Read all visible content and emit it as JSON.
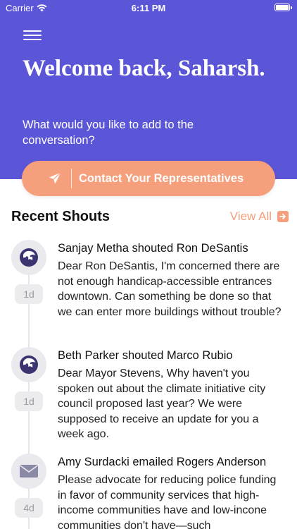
{
  "status_bar": {
    "carrier": "Carrier",
    "time": "6:11 PM"
  },
  "header": {
    "welcome": "Welcome back, Saharsh.",
    "subtitle": "What would you like to add to the conversation?",
    "background_color": "#5b55d8"
  },
  "contact_button": {
    "label": "Contact Your Representatives",
    "icon": "paper-plane-icon",
    "color": "#f59f7c"
  },
  "recent": {
    "title": "Recent Shouts",
    "view_all": "View All"
  },
  "shouts": [
    {
      "title": "Sanjay Metha shouted Ron DeSantis",
      "body": "Dear Ron DeSantis, I'm concerned there are not enough handicap-accessible entrances downtown. Can something be done so that we can enter more buildings without trouble?",
      "time": "1d",
      "icon": "lion-logo-icon"
    },
    {
      "title": "Beth Parker shouted Marco Rubio",
      "body": "Dear Mayor Stevens, Why haven't you spoken out about the climate initiative city council proposed last year? We were supposed to receive an update for you a week ago.",
      "time": "1d",
      "icon": "lion-logo-icon"
    },
    {
      "title": "Amy Surdacki emailed Rogers Anderson",
      "body": "Please advocate for reducing police funding in favor of community services that high-income communities have and low-incone communities don't have—such",
      "time": "4d",
      "icon": "envelope-icon"
    }
  ]
}
